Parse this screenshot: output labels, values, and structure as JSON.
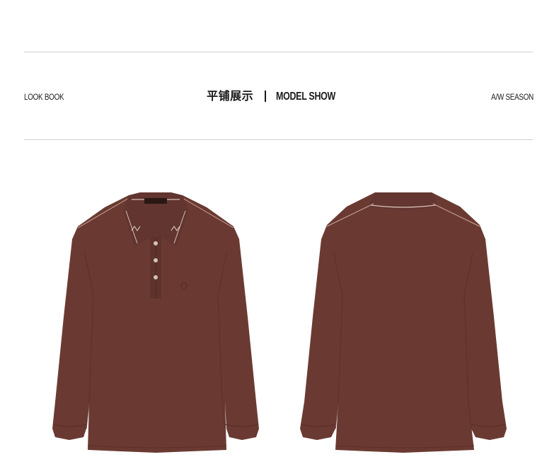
{
  "header": {
    "left_label": "LOOK BOOK",
    "title_cn": "平铺展示",
    "title_en": "MODEL SHOW",
    "right_label": "A/W SEASON"
  },
  "colors": {
    "shirt": "#6a3a32",
    "shirt_shadow": "#5a3028",
    "piping": "#c9a89a",
    "rule": "#cfcfcf"
  },
  "images": {
    "front_view": "polo-shirt-front",
    "back_view": "polo-shirt-back"
  }
}
